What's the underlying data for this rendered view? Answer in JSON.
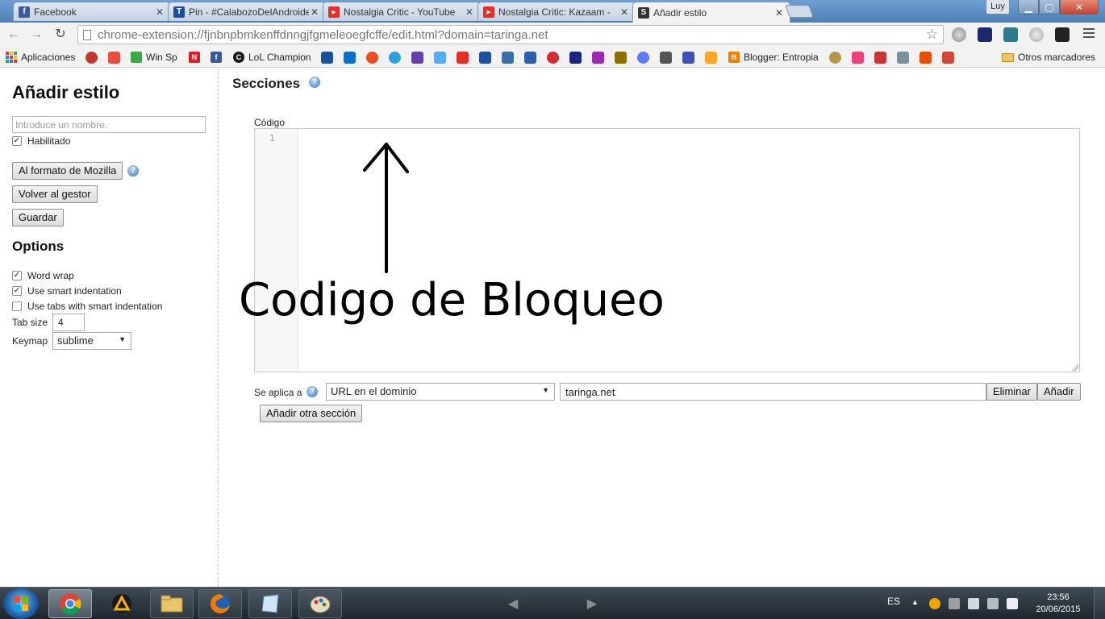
{
  "browser": {
    "tabs": [
      {
        "title": "Facebook",
        "favicon": "facebook-icon",
        "color": "#3b5998",
        "glyph": "f",
        "active": false
      },
      {
        "title": "Pin - #CalabozoDelAndroide",
        "favicon": "taringa-icon",
        "color": "#1e4f9c",
        "glyph": "T",
        "active": false
      },
      {
        "title": "Nostalgia Critic - YouTube",
        "favicon": "youtube-icon",
        "color": "#e52d27",
        "glyph": "▶",
        "active": false
      },
      {
        "title": "Nostalgia Critic: Kazaam -",
        "favicon": "youtube-icon",
        "color": "#e52d27",
        "glyph": "▶",
        "active": false
      },
      {
        "title": "Añadir estilo",
        "favicon": "stylish-icon",
        "color": "#333333",
        "glyph": "S",
        "active": true
      }
    ],
    "user_label": "Luy",
    "url": "chrome-extension://fjnbnpbmkenffdnngjfgmeleoegfcffe/edit.html?domain=taringa.net"
  },
  "bookmarks": {
    "apps_label": "Aplicaciones",
    "items": [
      {
        "label": "",
        "icon": "red-disc-icon",
        "color": "#c0392b"
      },
      {
        "label": "",
        "icon": "red-flower-icon",
        "color": "#e74c3c"
      },
      {
        "label": "Win Sp",
        "icon": "green-figure-icon",
        "color": "#3aa845"
      },
      {
        "label": "",
        "icon": "netflix-icon",
        "color": "#d81f26"
      },
      {
        "label": "",
        "icon": "facebook-icon",
        "color": "#3b5998"
      },
      {
        "label": "LoL Champion",
        "icon": "lol-icon",
        "color": "#1a1a1a"
      },
      {
        "label": "Blogger: Entropia",
        "icon": "blogger-icon",
        "color": "#f57d00"
      },
      {
        "label": "Otros marcadores",
        "icon": "folder-icon",
        "color": "#e8c46a"
      }
    ],
    "icon_colors": [
      "#1e4f9c",
      "#0a72c6",
      "#e8501f",
      "#2ba0d9",
      "#6441a5",
      "#55acee",
      "#e52d27",
      "#1e4f9c",
      "#3b6ea8",
      "#2b5fad",
      "#d32f2f",
      "#1a237e",
      "#9c27b0",
      "#8d6e00",
      "#5c7cfa",
      "#555555",
      "#3f51b5",
      "#f9a825",
      "#b9974a",
      "#ec407a",
      "#cc3333",
      "#78909c",
      "#e65100",
      "#d14836"
    ]
  },
  "sidebar": {
    "title": "Añadir estilo",
    "name_placeholder": "Introduce un nombre.",
    "enabled_label": "Habilitado",
    "mozilla_button": "Al formato de Mozilla",
    "back_button": "Volver al gestor",
    "save_button": "Guardar",
    "options_title": "Options",
    "options": [
      {
        "label": "Word wrap",
        "checked": true
      },
      {
        "label": "Use smart indentation",
        "checked": true
      },
      {
        "label": "Use tabs with smart indentation",
        "checked": false
      }
    ],
    "tab_size_label": "Tab size",
    "tab_size_value": "4",
    "keymap_label": "Keymap",
    "keymap_value": "sublime"
  },
  "main": {
    "sections_title": "Secciones",
    "code_label": "Código",
    "line_number": "1",
    "annotation": "Codigo de Bloqueo",
    "applies_label": "Se aplica a",
    "applies_select": "URL en el dominio",
    "applies_value": "taringa.net",
    "remove_button": "Eliminar",
    "add_button": "Añadir",
    "add_section_button": "Añadir otra sección"
  },
  "taskbar": {
    "language": "ES",
    "time": "23:56",
    "date": "20/06/2015"
  }
}
